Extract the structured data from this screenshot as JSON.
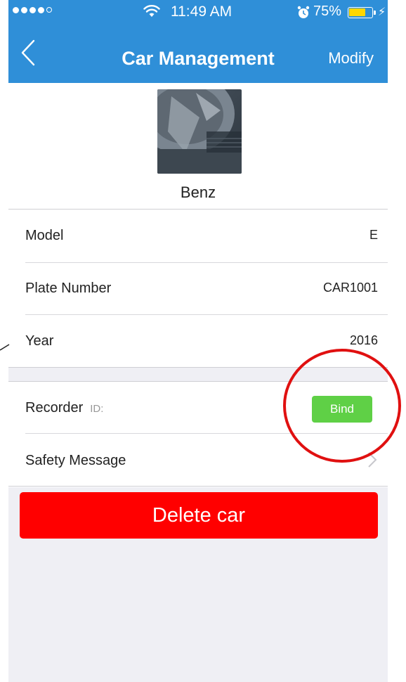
{
  "status_bar": {
    "time": "11:49 AM",
    "battery": "75%",
    "battery_level": 0.75,
    "signal_bars_filled": 4,
    "signal_bars_total": 5
  },
  "nav": {
    "title": "Car Management",
    "modify_label": "Modify"
  },
  "car": {
    "name": "Benz"
  },
  "details": [
    {
      "label": "Model",
      "value": "E"
    },
    {
      "label": "Plate Number",
      "value": "CAR1001"
    },
    {
      "label": "Year",
      "value": "2016"
    }
  ],
  "recorder": {
    "label": "Recorder",
    "id_label": "ID:",
    "bind_label": "Bind"
  },
  "safety_message": {
    "label": "Safety Message"
  },
  "delete_label": "Delete car",
  "colors": {
    "nav_blue": "#2f8fd8",
    "bind_green": "#5fd046",
    "delete_red": "#ff0000",
    "annotation_red": "#e01010",
    "background": "#efeff4"
  }
}
